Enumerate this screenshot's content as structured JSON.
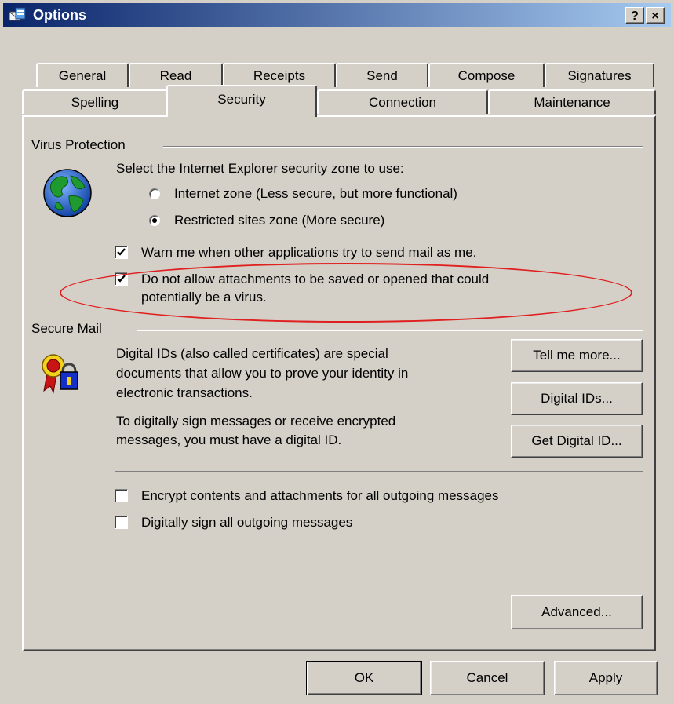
{
  "window": {
    "title": "Options",
    "help_button": "?",
    "close_button": "×",
    "icon": "mail-options-icon"
  },
  "tabs": {
    "row_back": [
      "General",
      "Read",
      "Receipts",
      "Send",
      "Compose",
      "Signatures"
    ],
    "row_front": [
      "Spelling",
      "Security",
      "Connection",
      "Maintenance"
    ],
    "active": "Security"
  },
  "virus_protection": {
    "label": "Virus Protection",
    "icon": "globe-icon",
    "zone_prompt": "Select the Internet Explorer security zone to use:",
    "zones": [
      {
        "label": "Internet zone (Less secure, but more functional)",
        "selected": false
      },
      {
        "label": "Restricted sites zone (More secure)",
        "selected": true
      }
    ],
    "warn_label": "Warn me when other applications try to send mail as me.",
    "warn_checked": true,
    "attach_label_line1": "Do not allow attachments to be saved or opened that could",
    "attach_label_line2": "potentially be a virus.",
    "attach_checked": true
  },
  "secure_mail": {
    "label": "Secure Mail",
    "icon": "certificate-lock-icon",
    "desc_line1": "Digital IDs (also called certificates) are special",
    "desc_line2": "documents that allow you to prove your identity in",
    "desc_line3": "electronic transactions.",
    "sign_line1": "To digitally sign messages or receive encrypted",
    "sign_line2": "messages, you must have a digital ID.",
    "tell_me_more": "Tell me more...",
    "digital_ids": "Digital IDs...",
    "get_digital_id": "Get Digital ID...",
    "encrypt_label": "Encrypt contents and attachments for all outgoing messages",
    "encrypt_checked": false,
    "sign_label": "Digitally sign all outgoing messages",
    "sign_checked": false,
    "advanced": "Advanced..."
  },
  "footer": {
    "ok": "OK",
    "cancel": "Cancel",
    "apply": "Apply"
  },
  "colors": {
    "face": "#d4d0c8",
    "titlebar_start": "#0a246a",
    "titlebar_end": "#a6caf0",
    "annotation": "#e02020"
  }
}
